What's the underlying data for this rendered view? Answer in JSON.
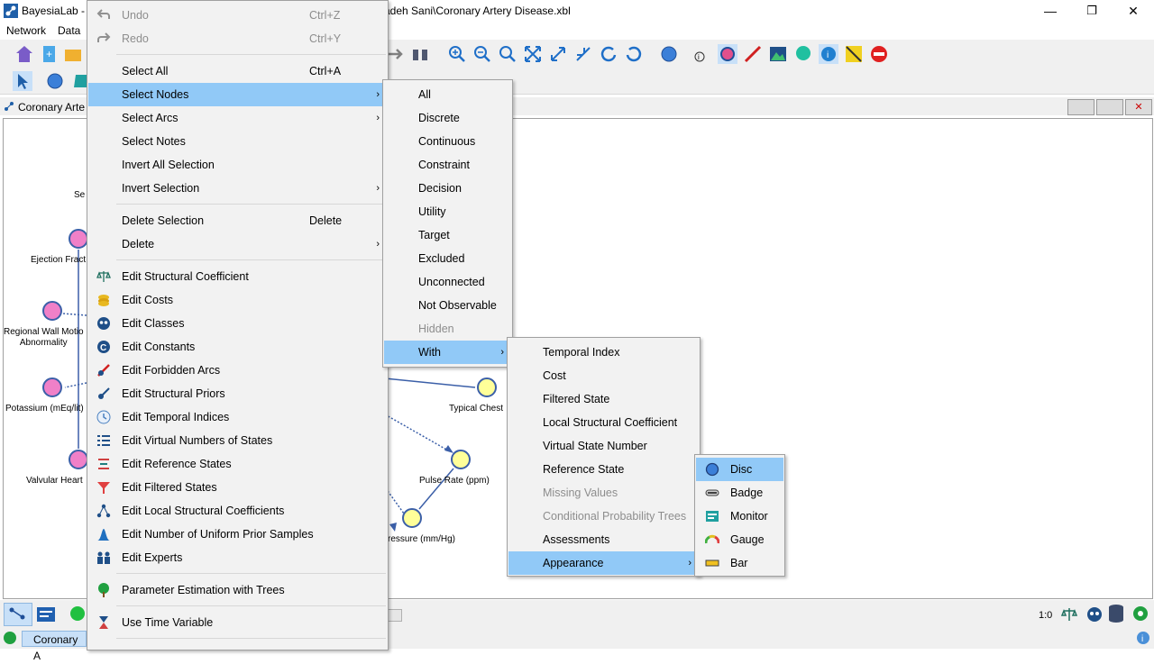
{
  "window": {
    "title_left": "BayesiaLab - C",
    "title_right": "adeh Sani\\Coronary Artery Disease.xbl",
    "minimize": "—",
    "restore": "❐",
    "close": "✕"
  },
  "menubar": {
    "items": [
      "Network",
      "Data"
    ]
  },
  "doc_tab": {
    "title": "Coronary Arte"
  },
  "canvas": {
    "labels": {
      "se": "Se",
      "ejection": "Ejection Fract",
      "regional": "Regional Wall Motio\nAbnormality",
      "potassium": "Potassium (mEq/lit)",
      "valvular": "Valvular Heart",
      "typical": "Typical Chest",
      "pulse": "Pulse Rate (ppm)",
      "pressure": "ressure (mm/Hg)"
    }
  },
  "status": {
    "zoom": "1:0",
    "tab": "Coronary A"
  },
  "edit_menu": {
    "undo": {
      "label": "Undo",
      "shortcut": "Ctrl+Z"
    },
    "redo": {
      "label": "Redo",
      "shortcut": "Ctrl+Y"
    },
    "select_all": {
      "label": "Select All",
      "shortcut": "Ctrl+A"
    },
    "select_nodes": "Select Nodes",
    "select_arcs": "Select Arcs",
    "select_notes": "Select Notes",
    "invert_all": "Invert All Selection",
    "invert": "Invert Selection",
    "delete_selection": {
      "label": "Delete Selection",
      "shortcut": "Delete"
    },
    "delete": "Delete",
    "edit_items": [
      "Edit Structural Coefficient",
      "Edit Costs",
      "Edit Classes",
      "Edit Constants",
      "Edit Forbidden Arcs",
      "Edit Structural Priors",
      "Edit Temporal Indices",
      "Edit Virtual Numbers of States",
      "Edit Reference States",
      "Edit Filtered States",
      "Edit Local Structural Coefficients",
      "Edit Number of Uniform Prior Samples",
      "Edit Experts"
    ],
    "param_trees": "Parameter Estimation with Trees",
    "time_var": "Use Time Variable"
  },
  "select_nodes_menu": {
    "items": [
      "All",
      "Discrete",
      "Continuous",
      "Constraint",
      "Decision",
      "Utility",
      "Target",
      "Excluded",
      "Unconnected",
      "Not Observable",
      "Hidden"
    ],
    "with": "With"
  },
  "with_menu": {
    "items": [
      "Temporal Index",
      "Cost",
      "Filtered State",
      "Local Structural Coefficient",
      "Virtual State Number",
      "Reference State",
      "Missing Values",
      "Conditional Probability Trees",
      "Assessments",
      "Appearance"
    ]
  },
  "appearance_menu": {
    "items": [
      "Disc",
      "Badge",
      "Monitor",
      "Gauge",
      "Bar"
    ]
  },
  "colors": {
    "highlight": "#91c9f7",
    "node_pink": "#f080c8",
    "node_yellow": "#ffff99",
    "node_border": "#3b5fa8"
  }
}
